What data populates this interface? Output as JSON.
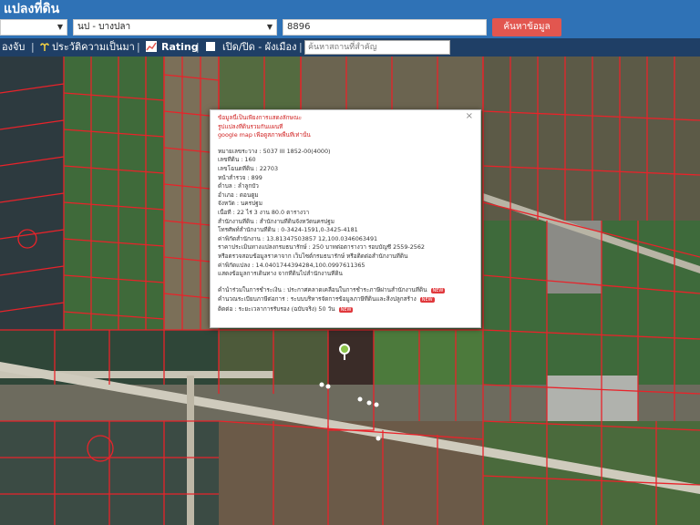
{
  "header": {
    "title": "แปลงที่ดิน"
  },
  "search": {
    "province_value": "",
    "amphoe_value": "นป - บางปลา",
    "parcel_value": "8896",
    "search_button": "ค้นหาข้อมูล"
  },
  "toolbar": {
    "items": [
      "องจับ",
      "ประวัติความเป็นมา",
      "Rating",
      "เปิด/ปิด - ผังเมือง"
    ],
    "separator": "|",
    "place_placeholder": "ค้นหาสถานที่สำคัญ"
  },
  "popup": {
    "warning": [
      "ข้อมูลนี้เป็นเพียงการแสดงลักษณะ",
      "รูปแปลงที่ดินรวมกันแผนที่",
      "google map เพื่อดูสภาพพื้นที่เท่านั้น"
    ],
    "fields": [
      "หมายเลขระวาง : 5037 III 1852-00(4000)",
      "เลขที่ดิน : 160",
      "เลขโฉนดที่ดิน : 22703",
      "หน้าสำรวจ : 899",
      "ตำบล : ลำลูกบัว",
      "อำเภอ : ดอนตูม",
      "จังหวัด : นครปฐม",
      "เนื้อที่ : 22 ไร่ 3 งาน 80.0 ตารางวา",
      "สำนักงานที่ดิน : สำนักงานที่ดินจังหวัดนครปฐม",
      "โทรศัพท์สำนักงานที่ดิน : 0-3424-1591,0-3425-4181",
      "ค่าพิกัดสำนักงาน : 13.81347503857 12,100.0346063491",
      "ราคาประเมินทางแปลงกรมธนารักษ์ : 250 บาทต่อตารางวา รอบบัญชี 2559-2562",
      "หรือตรวจสอบข้อมูลราคาจาก เว็บไซต์กรมธนารักษ์ หรือติดต่อสำนักงานที่ดิน",
      "ค่าพิกัดแปลง : 14.0401744394284,100.0997611365",
      "แสดงข้อมูลการเดินทาง จากที่ดินไปสำนักงานที่ดิน"
    ],
    "extra": [
      "คำนำร่วมในการชำระเงิน : ประกาศคลาดเคลื่อนในการชำระภาษีผ่านสำนักงานที่ดิน",
      "คำนวณระเบียบภาษีต่อการ : ระบบบริหารจัดการข้อมูลภาษีที่ดินและสิ่งปลูกสร้าง",
      "ติดต่อ : ระยะเวลาการรับรอง (ฉบับจริง) 50 วัน"
    ],
    "new_badge": "NEW",
    "close_label": "×"
  },
  "colors": {
    "header": "#2f72b6",
    "toolbar": "#1f3f66",
    "button": "#e2564f",
    "parcel_line": "#e8232a"
  }
}
